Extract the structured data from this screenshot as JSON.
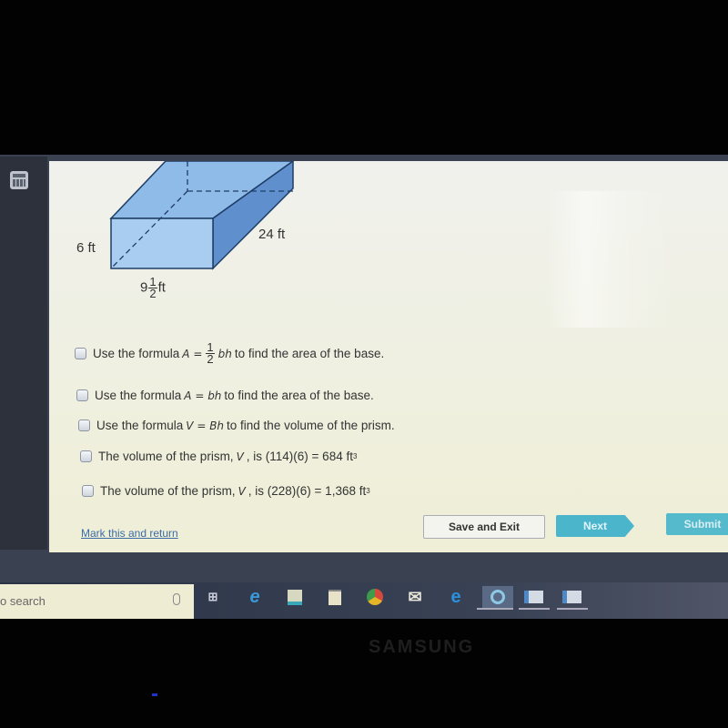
{
  "diagram": {
    "height_label": "6 ft",
    "length_label": "24 ft",
    "width_whole": "9",
    "width_frac_num": "1",
    "width_frac_den": "2",
    "width_unit": "ft",
    "colors": {
      "front": "#a9cdf0",
      "top": "#8fbbe8",
      "side": "#5f8fcc",
      "edge": "#1f3d66"
    }
  },
  "options": [
    {
      "pre": "Use the formula",
      "math": "A =",
      "frac_num": "1",
      "frac_den": "2",
      "math2": "bh",
      "post": "to find the area of the base."
    },
    {
      "pre": "Use the formula",
      "math": "A = bh",
      "post": "to find the area of the base."
    },
    {
      "pre": "Use the formula",
      "math": "V = Bh",
      "post": "to find the volume of the prism."
    },
    {
      "pre": "The volume of the prism,",
      "math": "V",
      "post": ", is (114)(6) = 684 ft",
      "sup": "3"
    },
    {
      "pre": "The volume of the prism,",
      "math": "V",
      "post": ", is (228)(6) = 1,368 ft",
      "sup": "3"
    }
  ],
  "footer": {
    "mark_link": "Mark this and return",
    "save_exit": "Save and Exit",
    "next": "Next",
    "submit": "Submit"
  },
  "taskbar": {
    "search_placeholder": "o search",
    "icons": [
      "task-view",
      "internet-explorer",
      "file-explorer",
      "store",
      "chrome",
      "mail",
      "edge",
      "active-app",
      "window-1",
      "window-2"
    ]
  },
  "bezel_brand": "SAMSUNG"
}
